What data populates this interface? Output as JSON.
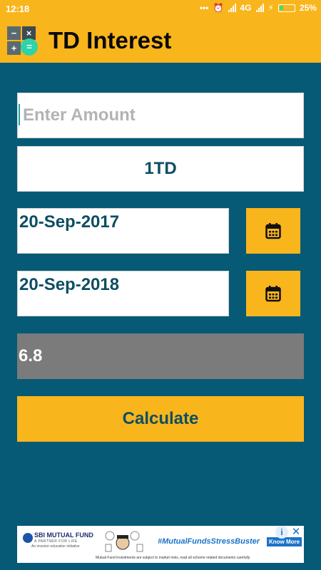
{
  "status_bar": {
    "time": "12:18",
    "network": "4G",
    "battery": "25%"
  },
  "app_bar": {
    "title": "TD Interest",
    "icon": "calculator-icon"
  },
  "form": {
    "amount_placeholder": "Enter Amount",
    "amount_value": "",
    "td_type": "1TD",
    "date_from": "20-Sep-2017",
    "date_to": "20-Sep-2018",
    "interest_rate": "6.8",
    "calculate_label": "Calculate",
    "calendar_icon": "calendar-icon"
  },
  "ad": {
    "brand": "SBI MUTUAL FUND",
    "tagline": "A PARTNER FOR LIFE",
    "initiative": "An investor education initiative",
    "hashtag": "#MutualFundsStressBuster",
    "cta": "Know More",
    "disclaimer": "Mutual Fund investments are subject to market risks, read all scheme related documents carefully."
  },
  "colors": {
    "accent": "#f9b51c",
    "background": "#065a76",
    "text_primary": "#0d4e63",
    "rate_box": "#7b7b7b"
  }
}
